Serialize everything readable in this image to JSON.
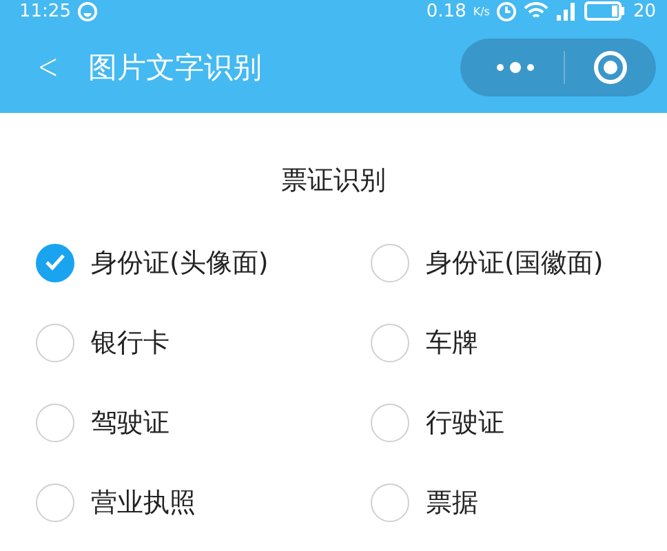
{
  "status_bar": {
    "time": "11:25",
    "speed": "0.18",
    "speed_unit": "K/s",
    "battery": "20"
  },
  "header": {
    "back": "<",
    "title": "图片文字识别"
  },
  "section": {
    "title": "票证识别"
  },
  "options": [
    {
      "label": "身份证(头像面)",
      "selected": true
    },
    {
      "label": "身份证(国徽面)",
      "selected": false
    },
    {
      "label": "银行卡",
      "selected": false
    },
    {
      "label": "车牌",
      "selected": false
    },
    {
      "label": "驾驶证",
      "selected": false
    },
    {
      "label": "行驶证",
      "selected": false
    },
    {
      "label": "营业执照",
      "selected": false
    },
    {
      "label": "票据",
      "selected": false
    }
  ]
}
